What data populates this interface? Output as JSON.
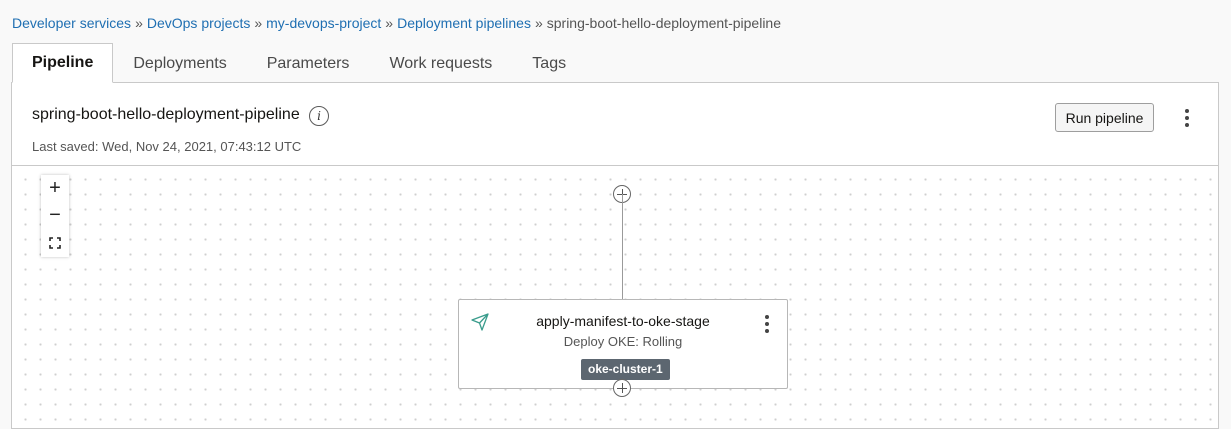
{
  "breadcrumb": {
    "items": [
      "Developer services",
      "DevOps projects",
      "my-devops-project",
      "Deployment pipelines"
    ],
    "current": "spring-boot-hello-deployment-pipeline",
    "separator": "»"
  },
  "tabs": [
    {
      "label": "Pipeline",
      "active": true
    },
    {
      "label": "Deployments",
      "active": false
    },
    {
      "label": "Parameters",
      "active": false
    },
    {
      "label": "Work requests",
      "active": false
    },
    {
      "label": "Tags",
      "active": false
    }
  ],
  "header": {
    "title": "spring-boot-hello-deployment-pipeline",
    "info_glyph": "i",
    "last_saved": "Last saved: Wed, Nov 24, 2021, 07:43:12 UTC",
    "run_button": "Run pipeline"
  },
  "zoom": {
    "in": "+",
    "out": "−"
  },
  "stage": {
    "name": "apply-manifest-to-oke-stage",
    "type": "Deploy OKE: Rolling",
    "badge": "oke-cluster-1",
    "icon": "send-icon",
    "icon_color": "#3a9c8c"
  },
  "colors": {
    "link": "#1f6fb2",
    "badge_bg": "#5c6670"
  }
}
